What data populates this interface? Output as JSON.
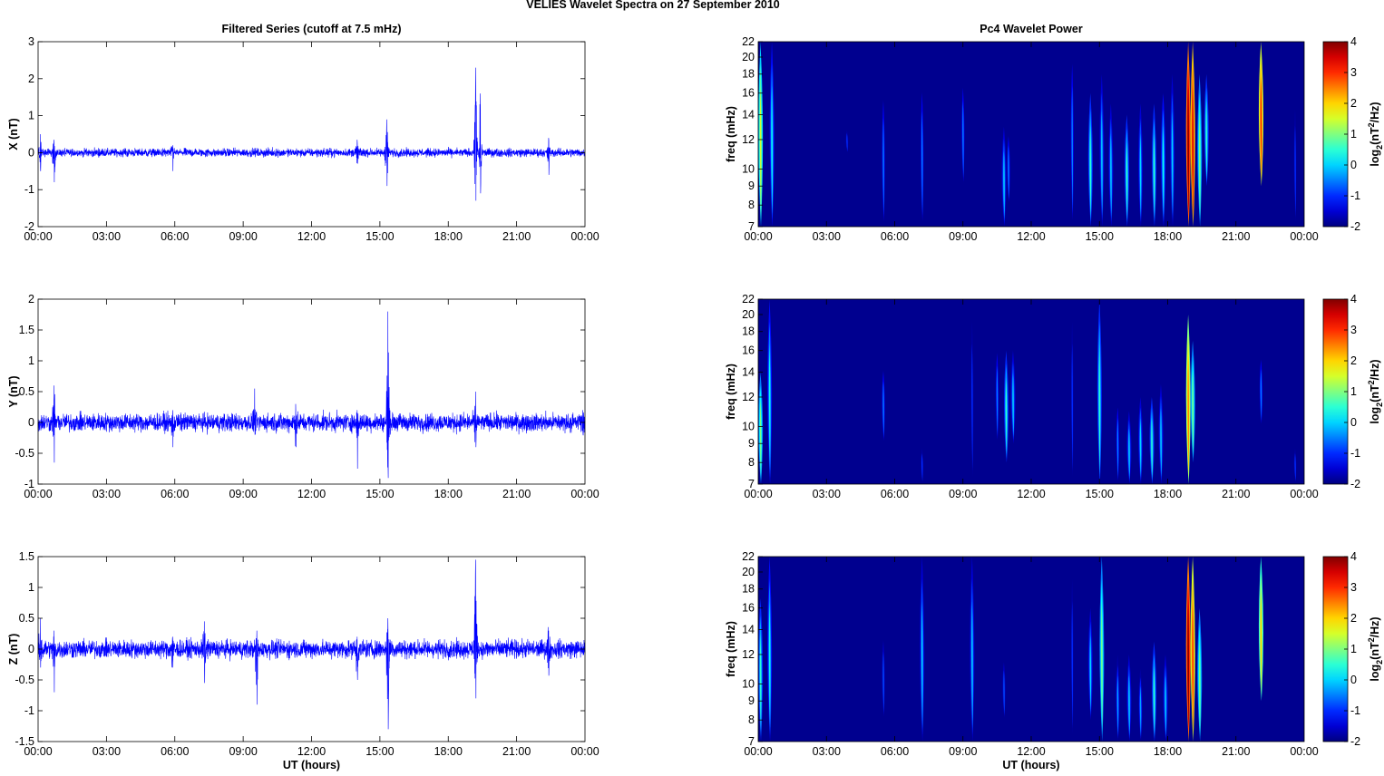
{
  "figure_title": "VELIES Wavelet Spectra on 27 September 2010",
  "colormap_background": "#00008F",
  "trace_color": "#0000FF",
  "chart_data": [
    {
      "type": "line",
      "panel": "X",
      "title": "Filtered Series (cutoff at 7.5 mHz)",
      "ylabel": "X (nT)",
      "xlabel": "",
      "xlim": [
        0,
        24
      ],
      "ylim": [
        -2,
        3
      ],
      "yticks": [
        3,
        2,
        1,
        0,
        -1,
        -2
      ],
      "xticklabels": [
        "00:00",
        "03:00",
        "06:00",
        "09:00",
        "12:00",
        "15:00",
        "18:00",
        "21:00",
        "00:00"
      ],
      "noise_amplitude": 0.1,
      "events": [
        {
          "t": 0.1,
          "max": 0.5,
          "min": -0.5
        },
        {
          "t": 0.7,
          "max": 0.35,
          "min": -0.8
        },
        {
          "t": 5.9,
          "max": 0.2,
          "min": -0.5
        },
        {
          "t": 14.0,
          "max": 0.35,
          "min": -0.3
        },
        {
          "t": 15.3,
          "max": 0.9,
          "min": -0.9
        },
        {
          "t": 19.2,
          "max": 2.3,
          "min": -1.3
        },
        {
          "t": 19.4,
          "max": 1.6,
          "min": -1.1
        },
        {
          "t": 22.4,
          "max": 0.4,
          "min": -0.6
        }
      ]
    },
    {
      "type": "line",
      "panel": "Y",
      "title": "",
      "ylabel": "Y (nT)",
      "xlabel": "",
      "xlim": [
        0,
        24
      ],
      "ylim": [
        -1,
        2
      ],
      "yticks": [
        2,
        1.5,
        1,
        0.5,
        0,
        -0.5,
        -1
      ],
      "xticklabels": [
        "00:00",
        "03:00",
        "06:00",
        "09:00",
        "12:00",
        "15:00",
        "18:00",
        "21:00",
        "00:00"
      ],
      "noise_amplitude": 0.13,
      "events": [
        {
          "t": 0.7,
          "max": 0.6,
          "min": -0.65
        },
        {
          "t": 5.9,
          "max": 0.2,
          "min": -0.4
        },
        {
          "t": 9.5,
          "max": 0.55,
          "min": -0.2
        },
        {
          "t": 11.3,
          "max": 0.3,
          "min": -0.4
        },
        {
          "t": 14.0,
          "max": 0.2,
          "min": -0.75
        },
        {
          "t": 15.35,
          "max": 1.8,
          "min": -0.9
        },
        {
          "t": 19.2,
          "max": 0.5,
          "min": -0.4
        },
        {
          "t": 23.9,
          "max": 0.2,
          "min": -0.2
        }
      ]
    },
    {
      "type": "line",
      "panel": "Z",
      "title": "",
      "ylabel": "Z (nT)",
      "xlabel": "UT (hours)",
      "xlim": [
        0,
        24
      ],
      "ylim": [
        -1.5,
        1.5
      ],
      "yticks": [
        1.5,
        1,
        0.5,
        0,
        -0.5,
        -1,
        -1.5
      ],
      "xticklabels": [
        "00:00",
        "03:00",
        "06:00",
        "09:00",
        "12:00",
        "15:00",
        "18:00",
        "21:00",
        "00:00"
      ],
      "noise_amplitude": 0.13,
      "events": [
        {
          "t": 0.1,
          "max": 0.5,
          "min": -0.3
        },
        {
          "t": 0.7,
          "max": 0.3,
          "min": -0.7
        },
        {
          "t": 5.9,
          "max": 0.2,
          "min": -0.3
        },
        {
          "t": 7.3,
          "max": 0.45,
          "min": -0.55
        },
        {
          "t": 9.6,
          "max": 0.3,
          "min": -0.9
        },
        {
          "t": 14.0,
          "max": 0.2,
          "min": -0.5
        },
        {
          "t": 15.35,
          "max": 0.5,
          "min": -1.3
        },
        {
          "t": 19.2,
          "max": 1.45,
          "min": -0.8
        },
        {
          "t": 22.4,
          "max": 0.3,
          "min": -0.4
        }
      ]
    },
    {
      "type": "heatmap",
      "panel": "X",
      "title": "Pc4 Wavelet Power",
      "ylabel": "freq (mHz)",
      "xlabel": "",
      "xlim": [
        0,
        24
      ],
      "ylim": [
        7,
        22
      ],
      "yscale": "log",
      "yticks": [
        22,
        20,
        18,
        16,
        14,
        12,
        10,
        9,
        8,
        7
      ],
      "xticklabels": [
        "00:00",
        "03:00",
        "06:00",
        "09:00",
        "12:00",
        "15:00",
        "18:00",
        "21:00",
        "00:00"
      ],
      "colorbar": {
        "range": [
          -2,
          4
        ],
        "ticks": [
          4,
          3,
          2,
          1,
          0,
          -1,
          -2
        ],
        "label": [
          "log",
          "2",
          "(nT",
          "2",
          "/Hz)"
        ]
      },
      "streaks": [
        [
          0.1,
          7,
          22,
          1.5
        ],
        [
          0.6,
          7,
          22,
          0.3
        ],
        [
          3.9,
          11,
          13,
          -1
        ],
        [
          5.5,
          7,
          17,
          -0.5
        ],
        [
          7.2,
          7,
          18,
          -0.5
        ],
        [
          9.0,
          9,
          18,
          -0.5
        ],
        [
          10.8,
          7,
          13,
          0
        ],
        [
          11.0,
          8,
          13,
          -0.5
        ],
        [
          13.8,
          7,
          22,
          -0.5
        ],
        [
          14.6,
          7,
          16,
          0.5
        ],
        [
          15.1,
          7,
          18,
          0
        ],
        [
          15.5,
          7,
          15,
          0
        ],
        [
          16.2,
          7,
          14,
          0.5
        ],
        [
          16.8,
          7,
          15,
          0
        ],
        [
          17.4,
          7,
          15,
          0.5
        ],
        [
          17.8,
          7,
          16,
          0.3
        ],
        [
          18.2,
          7,
          18,
          0
        ],
        [
          18.9,
          7,
          22,
          4
        ],
        [
          19.1,
          7,
          22,
          3.5
        ],
        [
          19.4,
          7,
          18,
          1
        ],
        [
          19.7,
          9,
          18,
          0.5
        ],
        [
          22.1,
          9,
          22,
          3
        ],
        [
          23.6,
          7,
          16,
          -1
        ]
      ]
    },
    {
      "type": "heatmap",
      "panel": "Y",
      "title": "",
      "ylabel": "freq (mHz)",
      "xlabel": "",
      "xlim": [
        0,
        24
      ],
      "ylim": [
        7,
        22
      ],
      "yscale": "log",
      "yticks": [
        22,
        20,
        18,
        16,
        14,
        12,
        10,
        9,
        8,
        7
      ],
      "xticklabels": [
        "00:00",
        "03:00",
        "06:00",
        "09:00",
        "12:00",
        "15:00",
        "18:00",
        "21:00",
        "00:00"
      ],
      "colorbar": {
        "range": [
          -2,
          4
        ],
        "ticks": [
          4,
          3,
          2,
          1,
          0,
          -1,
          -2
        ],
        "label": [
          "log",
          "2",
          "(nT",
          "2",
          "/Hz)"
        ]
      },
      "streaks": [
        [
          0.1,
          7,
          14,
          1
        ],
        [
          0.5,
          7,
          22,
          0.3
        ],
        [
          5.5,
          9,
          15,
          -0.5
        ],
        [
          7.2,
          7,
          9,
          -1
        ],
        [
          9.4,
          7,
          22,
          -1
        ],
        [
          10.5,
          9,
          17,
          -0.5
        ],
        [
          10.9,
          8,
          16,
          0.5
        ],
        [
          11.2,
          9,
          16,
          0
        ],
        [
          13.8,
          7,
          22,
          -1
        ],
        [
          15.0,
          7,
          22,
          0.5
        ],
        [
          15.8,
          7,
          12,
          -0.5
        ],
        [
          16.3,
          7,
          11,
          0
        ],
        [
          16.8,
          7,
          12,
          0
        ],
        [
          17.3,
          7,
          12,
          0.5
        ],
        [
          17.7,
          7,
          13,
          0
        ],
        [
          18.9,
          7,
          20,
          2.5
        ],
        [
          19.1,
          8,
          17,
          1
        ],
        [
          22.1,
          10,
          16,
          -0.5
        ],
        [
          23.6,
          7,
          9,
          -1
        ]
      ]
    },
    {
      "type": "heatmap",
      "panel": "Z",
      "title": "",
      "ylabel": "freq (mHz)",
      "xlabel": "UT (hours)",
      "xlim": [
        0,
        24
      ],
      "ylim": [
        7,
        22
      ],
      "yscale": "log",
      "yticks": [
        22,
        20,
        18,
        16,
        14,
        12,
        10,
        9,
        8,
        7
      ],
      "xticklabels": [
        "00:00",
        "03:00",
        "06:00",
        "09:00",
        "12:00",
        "15:00",
        "18:00",
        "21:00",
        "00:00"
      ],
      "colorbar": {
        "range": [
          -2,
          4
        ],
        "ticks": [
          4,
          3,
          2,
          1,
          0,
          -1,
          -2
        ],
        "label": [
          "log",
          "2",
          "(nT",
          "2",
          "/Hz)"
        ]
      },
      "streaks": [
        [
          0.1,
          7,
          17,
          0.5
        ],
        [
          0.5,
          7,
          22,
          0.3
        ],
        [
          5.5,
          8,
          14,
          -0.8
        ],
        [
          7.2,
          7,
          22,
          0
        ],
        [
          9.4,
          7,
          22,
          0
        ],
        [
          10.8,
          8,
          12,
          -0.8
        ],
        [
          13.8,
          7,
          22,
          -1
        ],
        [
          14.6,
          8,
          16,
          0
        ],
        [
          15.1,
          7,
          22,
          1
        ],
        [
          15.8,
          7,
          12,
          -0.3
        ],
        [
          16.3,
          7,
          12,
          0
        ],
        [
          16.8,
          7,
          11,
          -0.3
        ],
        [
          17.4,
          7,
          13,
          0.5
        ],
        [
          17.9,
          7,
          12,
          0
        ],
        [
          18.9,
          7,
          22,
          4
        ],
        [
          19.1,
          7,
          22,
          3
        ],
        [
          19.4,
          7,
          16,
          1
        ],
        [
          22.1,
          9,
          22,
          2
        ]
      ]
    }
  ]
}
